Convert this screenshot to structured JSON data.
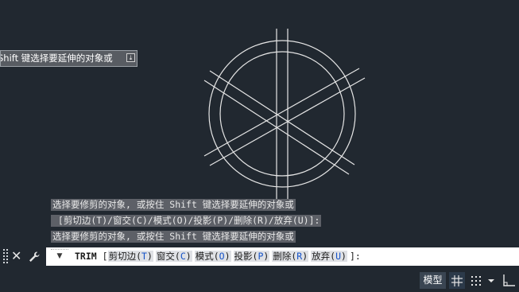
{
  "tooltip": {
    "text": "Shift 键选择要延伸的对象或"
  },
  "history": {
    "lines": [
      "选择要修剪的对象, 或按住 Shift 键选择要延伸的对象或",
      " [剪切边(T)/窗交(C)/模式(O)/投影(P)/删除(R)/放弃(U)]:",
      "选择要修剪的对象, 或按住 Shift 键选择要延伸的对象或"
    ]
  },
  "command_line": {
    "command": "TRIM",
    "open_bracket": "[",
    "options": [
      {
        "label": "剪切边(",
        "key": "T",
        "close": ")"
      },
      {
        "label": "窗交(",
        "key": "C",
        "close": ")"
      },
      {
        "label": "模式(",
        "key": "O",
        "close": ")"
      },
      {
        "label": "投影(",
        "key": "P",
        "close": ")"
      },
      {
        "label": "删除(",
        "key": "R",
        "close": ")"
      },
      {
        "label": "放弃(",
        "key": "U",
        "close": ")"
      }
    ],
    "close_bracket": "]:"
  },
  "status_bar": {
    "model_label": "模型"
  },
  "colors": {
    "background": "#212830",
    "option_key": "#1452c8",
    "drawing_lines": "#e6e6e6"
  }
}
